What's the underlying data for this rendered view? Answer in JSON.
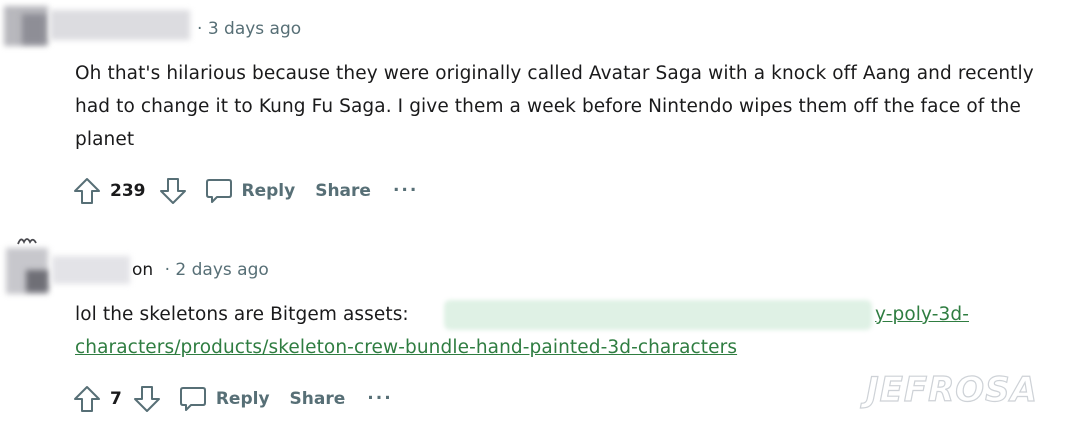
{
  "comments": [
    {
      "timestamp": "3 days ago",
      "body": "Oh that's hilarious because they were originally called Avatar Saga with a knock off Aang and recently had to change it to Kung Fu Saga. I give them a week before Nintendo wipes them off the face of the planet",
      "upvotes": "239",
      "reply_label": "Reply",
      "share_label": "Share",
      "more_label": "..."
    },
    {
      "author_fragment": "on",
      "timestamp": "2 days ago",
      "body_prefix": "lol the skeletons are Bitgem assets:",
      "link_tail_line1": "y-poly-3d-",
      "link_line2": "characters/products/skeleton-crew-bundle-hand-painted-3d-characters",
      "upvotes": "7",
      "reply_label": "Reply",
      "share_label": "Share",
      "more_label": "..."
    }
  ],
  "separator": "·",
  "watermark": "JEFROSA",
  "colors": {
    "meta": "#576f76",
    "text": "#1a1a1b",
    "link": "#2f7d41",
    "link_highlight": "#dff1e5",
    "avatar_blur": "#b8b8bd"
  },
  "icons": {
    "upvote": "arrow-up-outline",
    "downvote": "arrow-down-outline",
    "reply": "speech-bubble-outline",
    "more": "horizontal-ellipsis"
  }
}
